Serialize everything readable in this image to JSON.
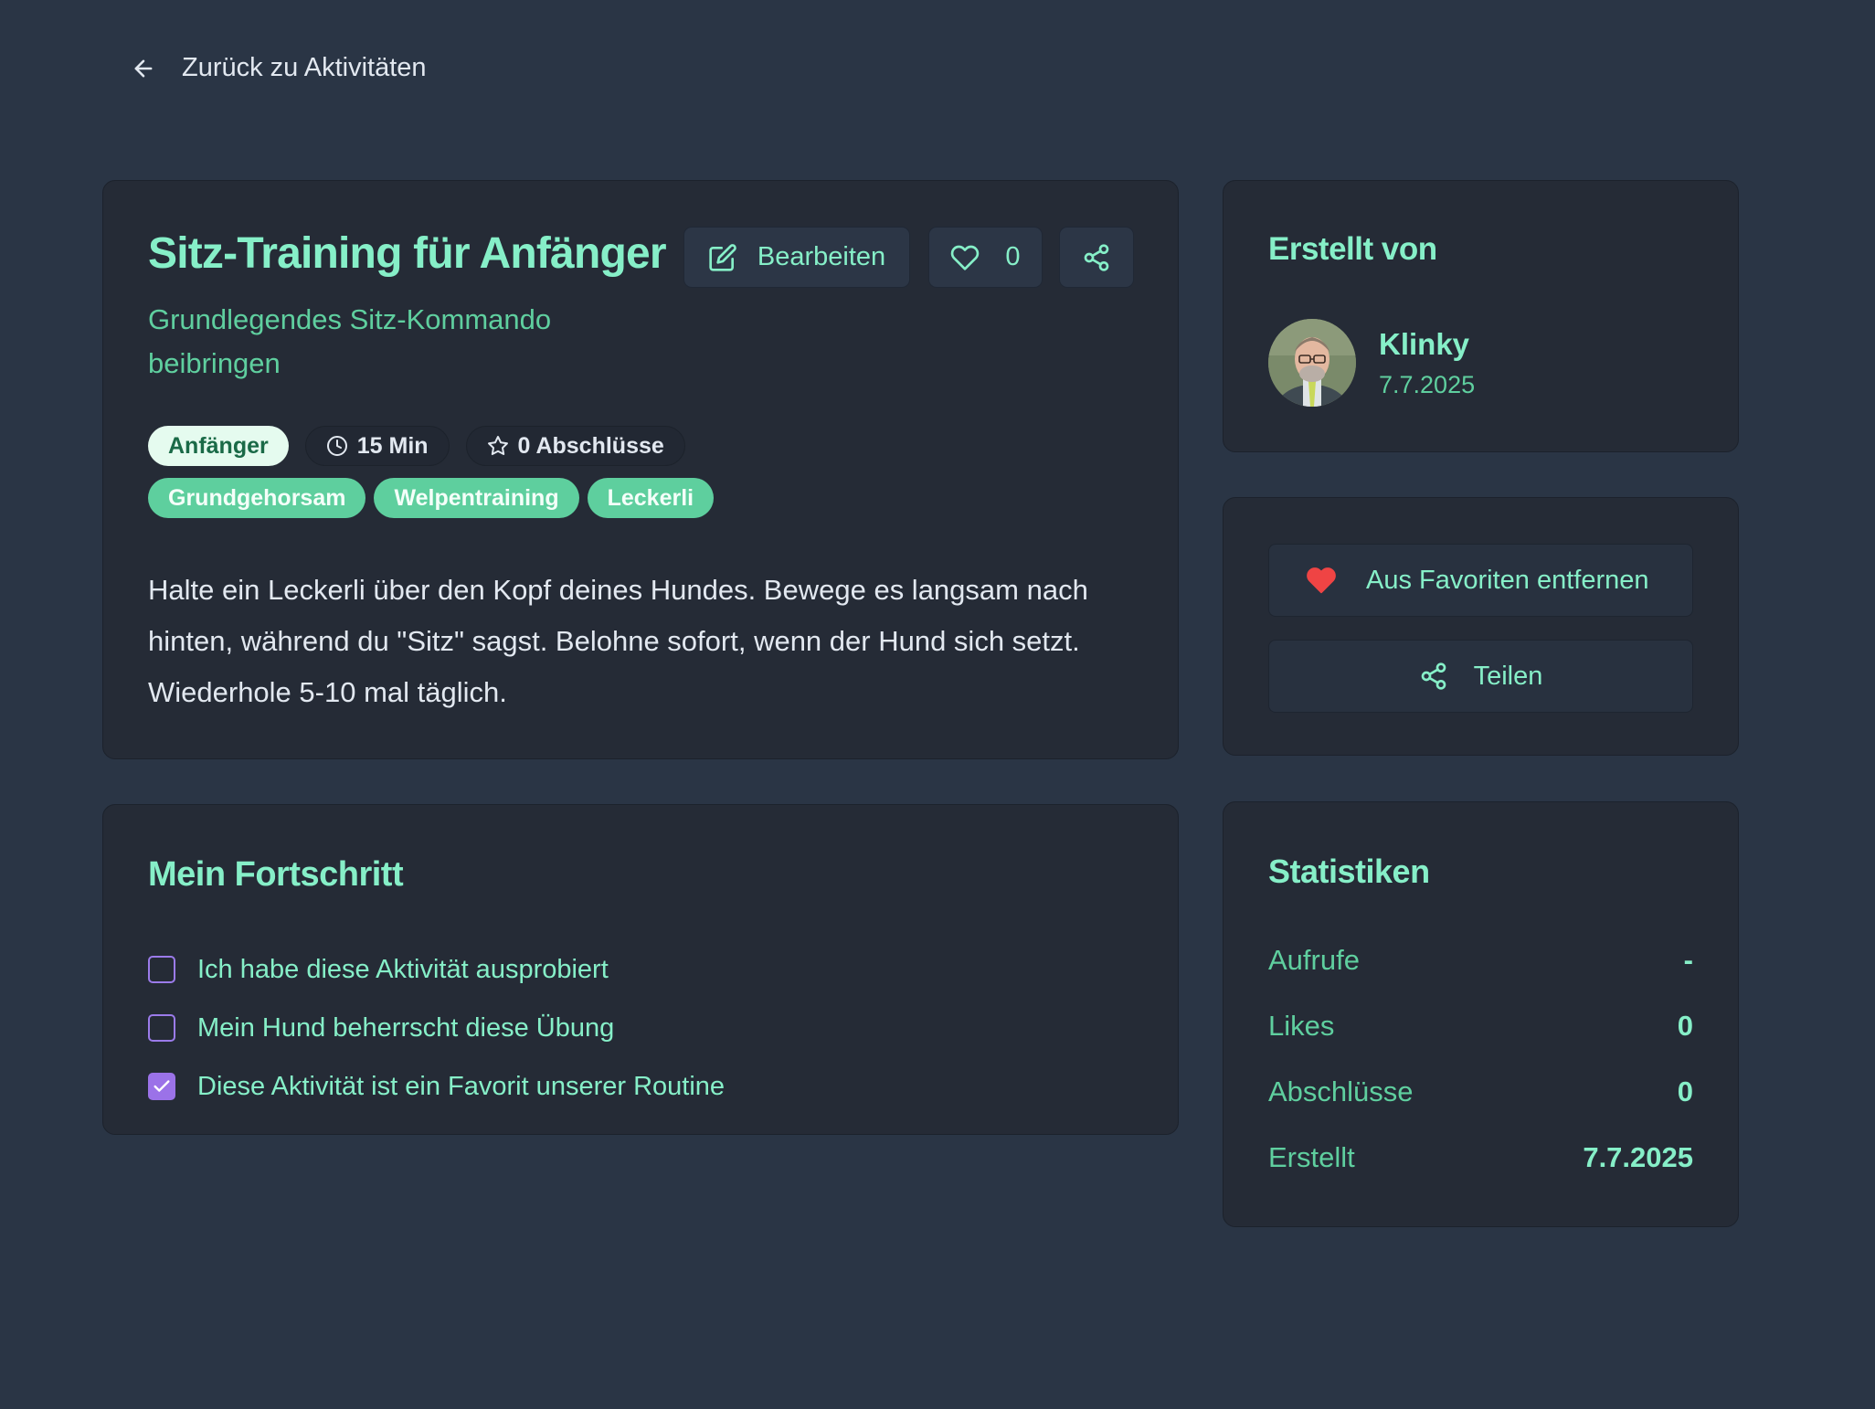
{
  "nav": {
    "back_label": "Zurück zu Aktivitäten",
    "back_icon": "arrow-left-icon"
  },
  "activity": {
    "title": "Sitz-Training für Anfänger",
    "subtitle": "Grundlegendes Sitz-Kommando beibringen",
    "edit_label": "Bearbeiten",
    "like_count": "0",
    "level": "Anfänger",
    "duration": "15 Min",
    "completions": "0 Abschlüsse",
    "tags": [
      "Grundgehorsam",
      "Welpentraining",
      "Leckerli"
    ],
    "description": "Halte ein Leckerli über den Kopf deines Hundes. Bewege es langsam nach hinten, während du \"Sitz\" sagst. Belohne sofort, wenn der Hund sich setzt. Wiederhole 5-10 mal täglich."
  },
  "progress": {
    "title": "Mein Fortschritt",
    "items": [
      {
        "label": "Ich habe diese Aktivität ausprobiert",
        "checked": false
      },
      {
        "label": "Mein Hund beherrscht diese Übung",
        "checked": false
      },
      {
        "label": "Diese Aktivität ist ein Favorit unserer Routine",
        "checked": true
      }
    ]
  },
  "author": {
    "title": "Erstellt von",
    "name": "Klinky",
    "date": "7.7.2025"
  },
  "actions": {
    "favorite_label": "Aus Favoriten entfernen",
    "share_label": "Teilen"
  },
  "stats": {
    "title": "Statistiken",
    "rows": [
      {
        "label": "Aufrufe",
        "value": "-"
      },
      {
        "label": "Likes",
        "value": "0"
      },
      {
        "label": "Abschlüsse",
        "value": "0"
      },
      {
        "label": "Erstellt",
        "value": "7.7.2025"
      }
    ]
  },
  "colors": {
    "background": "#2a3545",
    "card": "#252b36",
    "accent_text": "#86efc8",
    "muted_accent": "#5fcf9f",
    "tag": "#5ecf9e",
    "checkbox": "#9b72e8",
    "heart": "#ef4444"
  }
}
